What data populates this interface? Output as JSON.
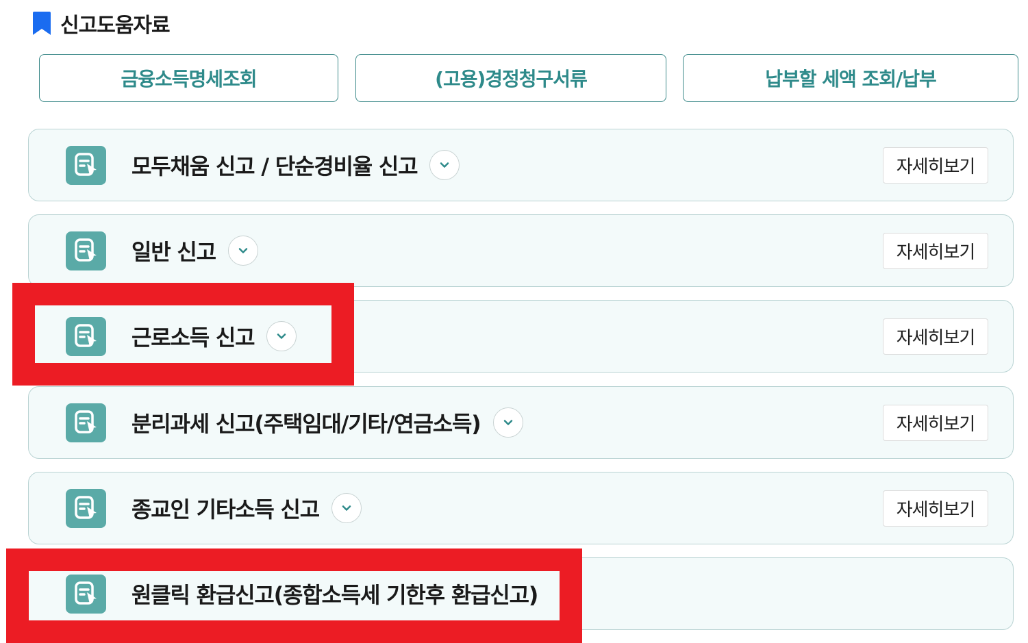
{
  "section": {
    "title": "신고도움자료",
    "icon": "bookmark-icon",
    "icon_color": "#1a6cf0"
  },
  "quick_links": [
    {
      "label": "금융소득명세조회"
    },
    {
      "label": "(고용)경정청구서류"
    },
    {
      "label": "납부할 세액 조회/납부"
    }
  ],
  "cards": [
    {
      "title": "모두채움 신고 / 단순경비율 신고",
      "has_toggle": true,
      "detail_label": "자세히보기"
    },
    {
      "title": "일반 신고",
      "has_toggle": true,
      "detail_label": "자세히보기"
    },
    {
      "title": "근로소득 신고",
      "has_toggle": true,
      "detail_label": "자세히보기"
    },
    {
      "title": "분리과세 신고(주택임대/기타/연금소득)",
      "has_toggle": true,
      "detail_label": "자세히보기"
    },
    {
      "title": "종교인 기타소득 신고",
      "has_toggle": true,
      "detail_label": "자세히보기"
    },
    {
      "title": "원클릭 환급신고(종합소득세 기한후 환급신고)",
      "has_toggle": false,
      "detail_label": ""
    }
  ],
  "colors": {
    "accent": "#2e8a8a",
    "card_bg": "#f3fafa",
    "icon_bg": "#5aaaa7",
    "highlight": "#ec1c24"
  }
}
